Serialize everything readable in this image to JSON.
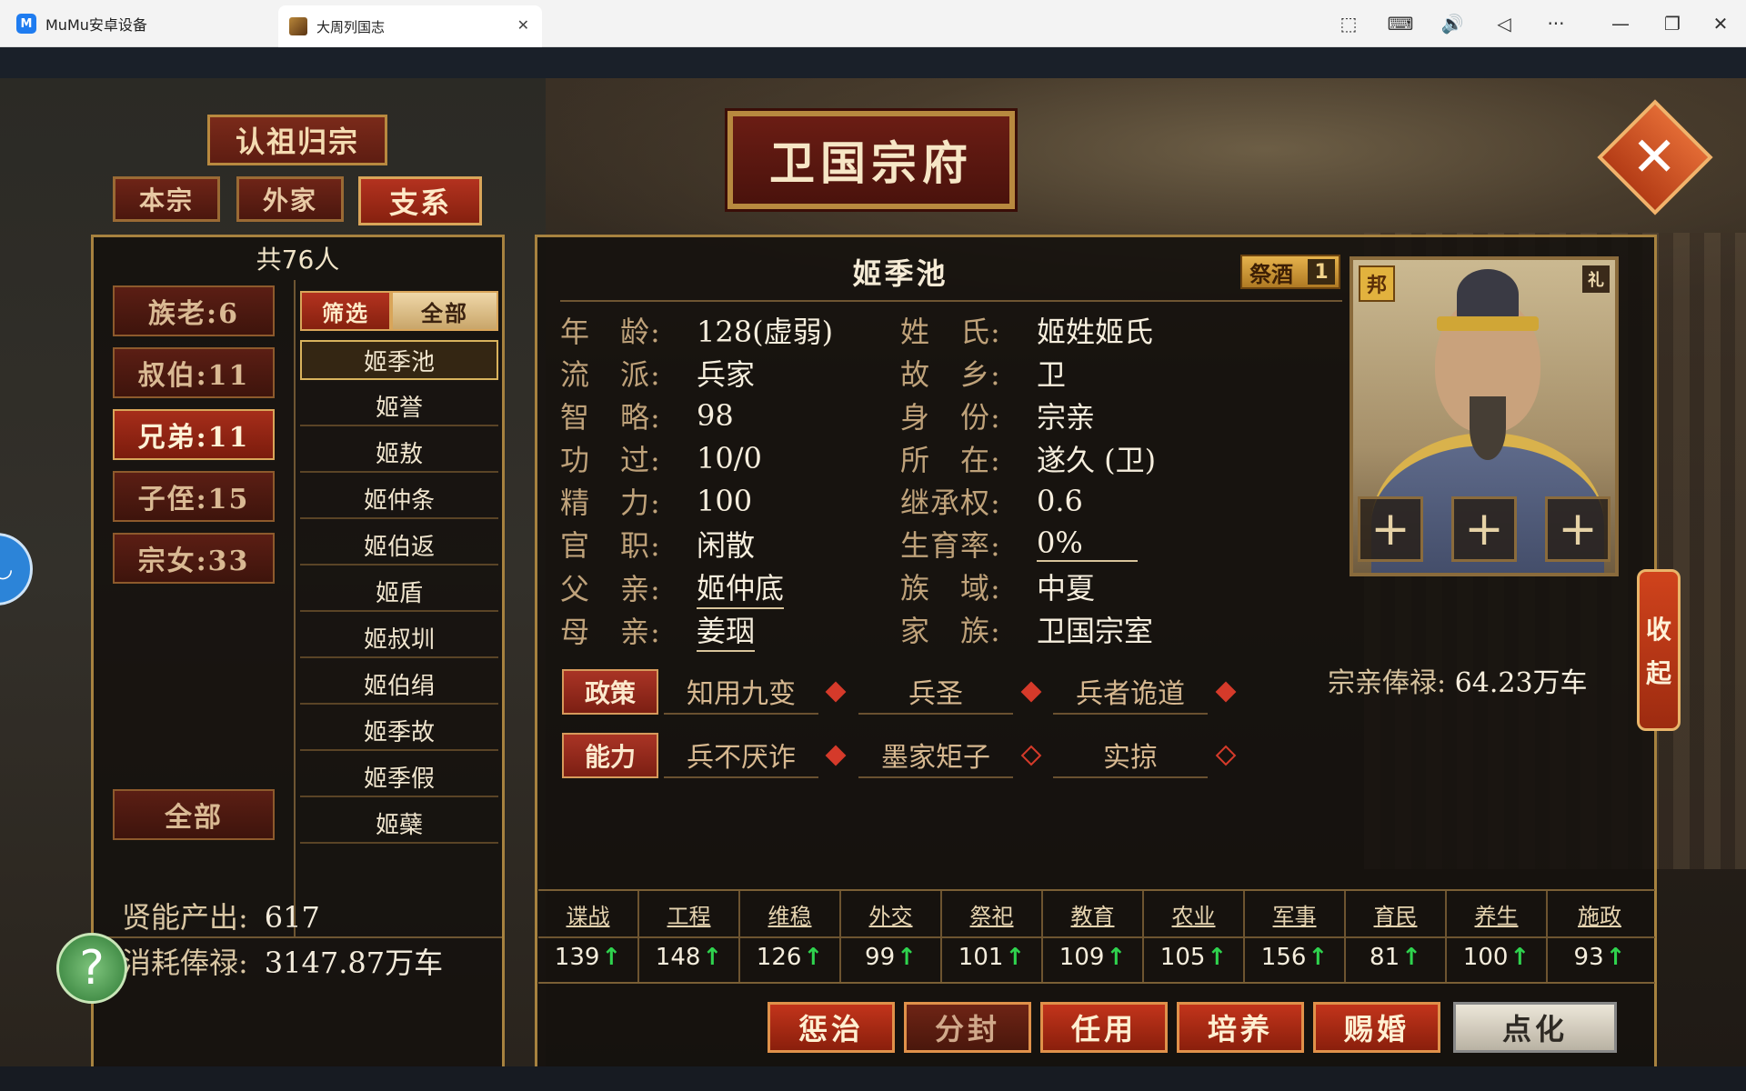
{
  "window": {
    "app_title": "MuMu安卓设备",
    "app_logo": "M",
    "tab_title": "大周列国志",
    "tab_close": "✕",
    "controls": [
      "⬚",
      "⌨",
      "🔊",
      "◁",
      "···",
      "—",
      "❐",
      "✕"
    ]
  },
  "header": {
    "title_plate": "认祖归宗",
    "main_title": "卫国宗府",
    "close_glyph": "✕",
    "tabs": [
      {
        "label": "本宗",
        "active": false
      },
      {
        "label": "外家",
        "active": false
      },
      {
        "label": "支系",
        "active": true
      }
    ]
  },
  "left": {
    "count": "共76人",
    "categories": [
      {
        "label": "族老:6",
        "active": false
      },
      {
        "label": "叔伯:11",
        "active": false
      },
      {
        "label": "兄弟:11",
        "active": true
      },
      {
        "label": "子侄:15",
        "active": false
      },
      {
        "label": "宗女:33",
        "active": false
      }
    ],
    "all_button": "全部",
    "filter_labels": [
      "筛选",
      "全部"
    ],
    "names": [
      "姬季池",
      "姬誉",
      "姬敖",
      "姬仲条",
      "姬伯返",
      "姬盾",
      "姬叔圳",
      "姬伯绢",
      "姬季故",
      "姬季假",
      "姬蘗"
    ],
    "selected_index": 0,
    "talent_output_label": "贤能产出:",
    "talent_output_value": "617",
    "salary_cost_label": "消耗俸禄:",
    "salary_cost_value": "3147.87万车",
    "help_glyph": "?",
    "side_float_glyph": "◡"
  },
  "character": {
    "name": "姬季池",
    "wine_label": "祭酒",
    "wine_count": "1",
    "left_rows": [
      {
        "label": "年　龄:",
        "value": "128(虚弱)",
        "link": false
      },
      {
        "label": "流　派:",
        "value": "兵家",
        "link": false
      },
      {
        "label": "智　略:",
        "value": "98",
        "link": false
      },
      {
        "label": "功　过:",
        "value": "10/0",
        "link": false
      },
      {
        "label": "精　力:",
        "value": "100",
        "link": false
      },
      {
        "label": "官　职:",
        "value": "闲散",
        "link": false
      },
      {
        "label": "父　亲:",
        "value": "姬仲底",
        "link": true
      },
      {
        "label": "母　亲:",
        "value": "姜珚",
        "link": true
      }
    ],
    "right_rows": [
      {
        "label": "姓　氏:",
        "value": "姬姓姬氏",
        "link": false
      },
      {
        "label": "故　乡:",
        "value": "卫",
        "link": false
      },
      {
        "label": "身　份:",
        "value": "宗亲",
        "link": false
      },
      {
        "label": "所　在:",
        "value": "遂久 (卫)",
        "link": false
      },
      {
        "label": "继承权:",
        "value": "0.6",
        "link": false
      },
      {
        "label": "生育率:",
        "value": "0%",
        "link": true
      },
      {
        "label": "族　域:",
        "value": "中夏",
        "link": false
      },
      {
        "label": "家　族:",
        "value": "卫国宗室",
        "link": false
      }
    ],
    "portrait_badges": {
      "left": "邦",
      "right": "礼"
    },
    "slot_glyph": "+",
    "salary_label": "宗亲俸禄:",
    "salary_value": "64.23万车",
    "collapse_chars": [
      "收",
      "起"
    ],
    "policy_tag": "政策",
    "policies": [
      {
        "name": "知用九变",
        "filled": true
      },
      {
        "name": "兵圣",
        "filled": true
      },
      {
        "name": "兵者诡道",
        "filled": true
      }
    ],
    "ability_tag": "能力",
    "abilities": [
      {
        "name": "兵不厌诈",
        "filled": true
      },
      {
        "name": "墨家矩子",
        "filled": false
      },
      {
        "name": "实掠",
        "filled": false
      }
    ],
    "up_arrow": "↑",
    "stats": [
      {
        "name": "谍战",
        "value": "139"
      },
      {
        "name": "工程",
        "value": "148"
      },
      {
        "name": "维稳",
        "value": "126"
      },
      {
        "name": "外交",
        "value": "99"
      },
      {
        "name": "祭祀",
        "value": "101"
      },
      {
        "name": "教育",
        "value": "109"
      },
      {
        "name": "农业",
        "value": "105"
      },
      {
        "name": "军事",
        "value": "156"
      },
      {
        "name": "育民",
        "value": "81"
      },
      {
        "name": "养生",
        "value": "100"
      },
      {
        "name": "施政",
        "value": "93"
      }
    ],
    "actions": [
      {
        "label": "惩治",
        "style": "normal"
      },
      {
        "label": "分封",
        "style": "dim"
      },
      {
        "label": "任用",
        "style": "normal"
      },
      {
        "label": "培养",
        "style": "normal"
      },
      {
        "label": "赐婚",
        "style": "normal"
      },
      {
        "label": "点化",
        "style": "light"
      }
    ]
  }
}
